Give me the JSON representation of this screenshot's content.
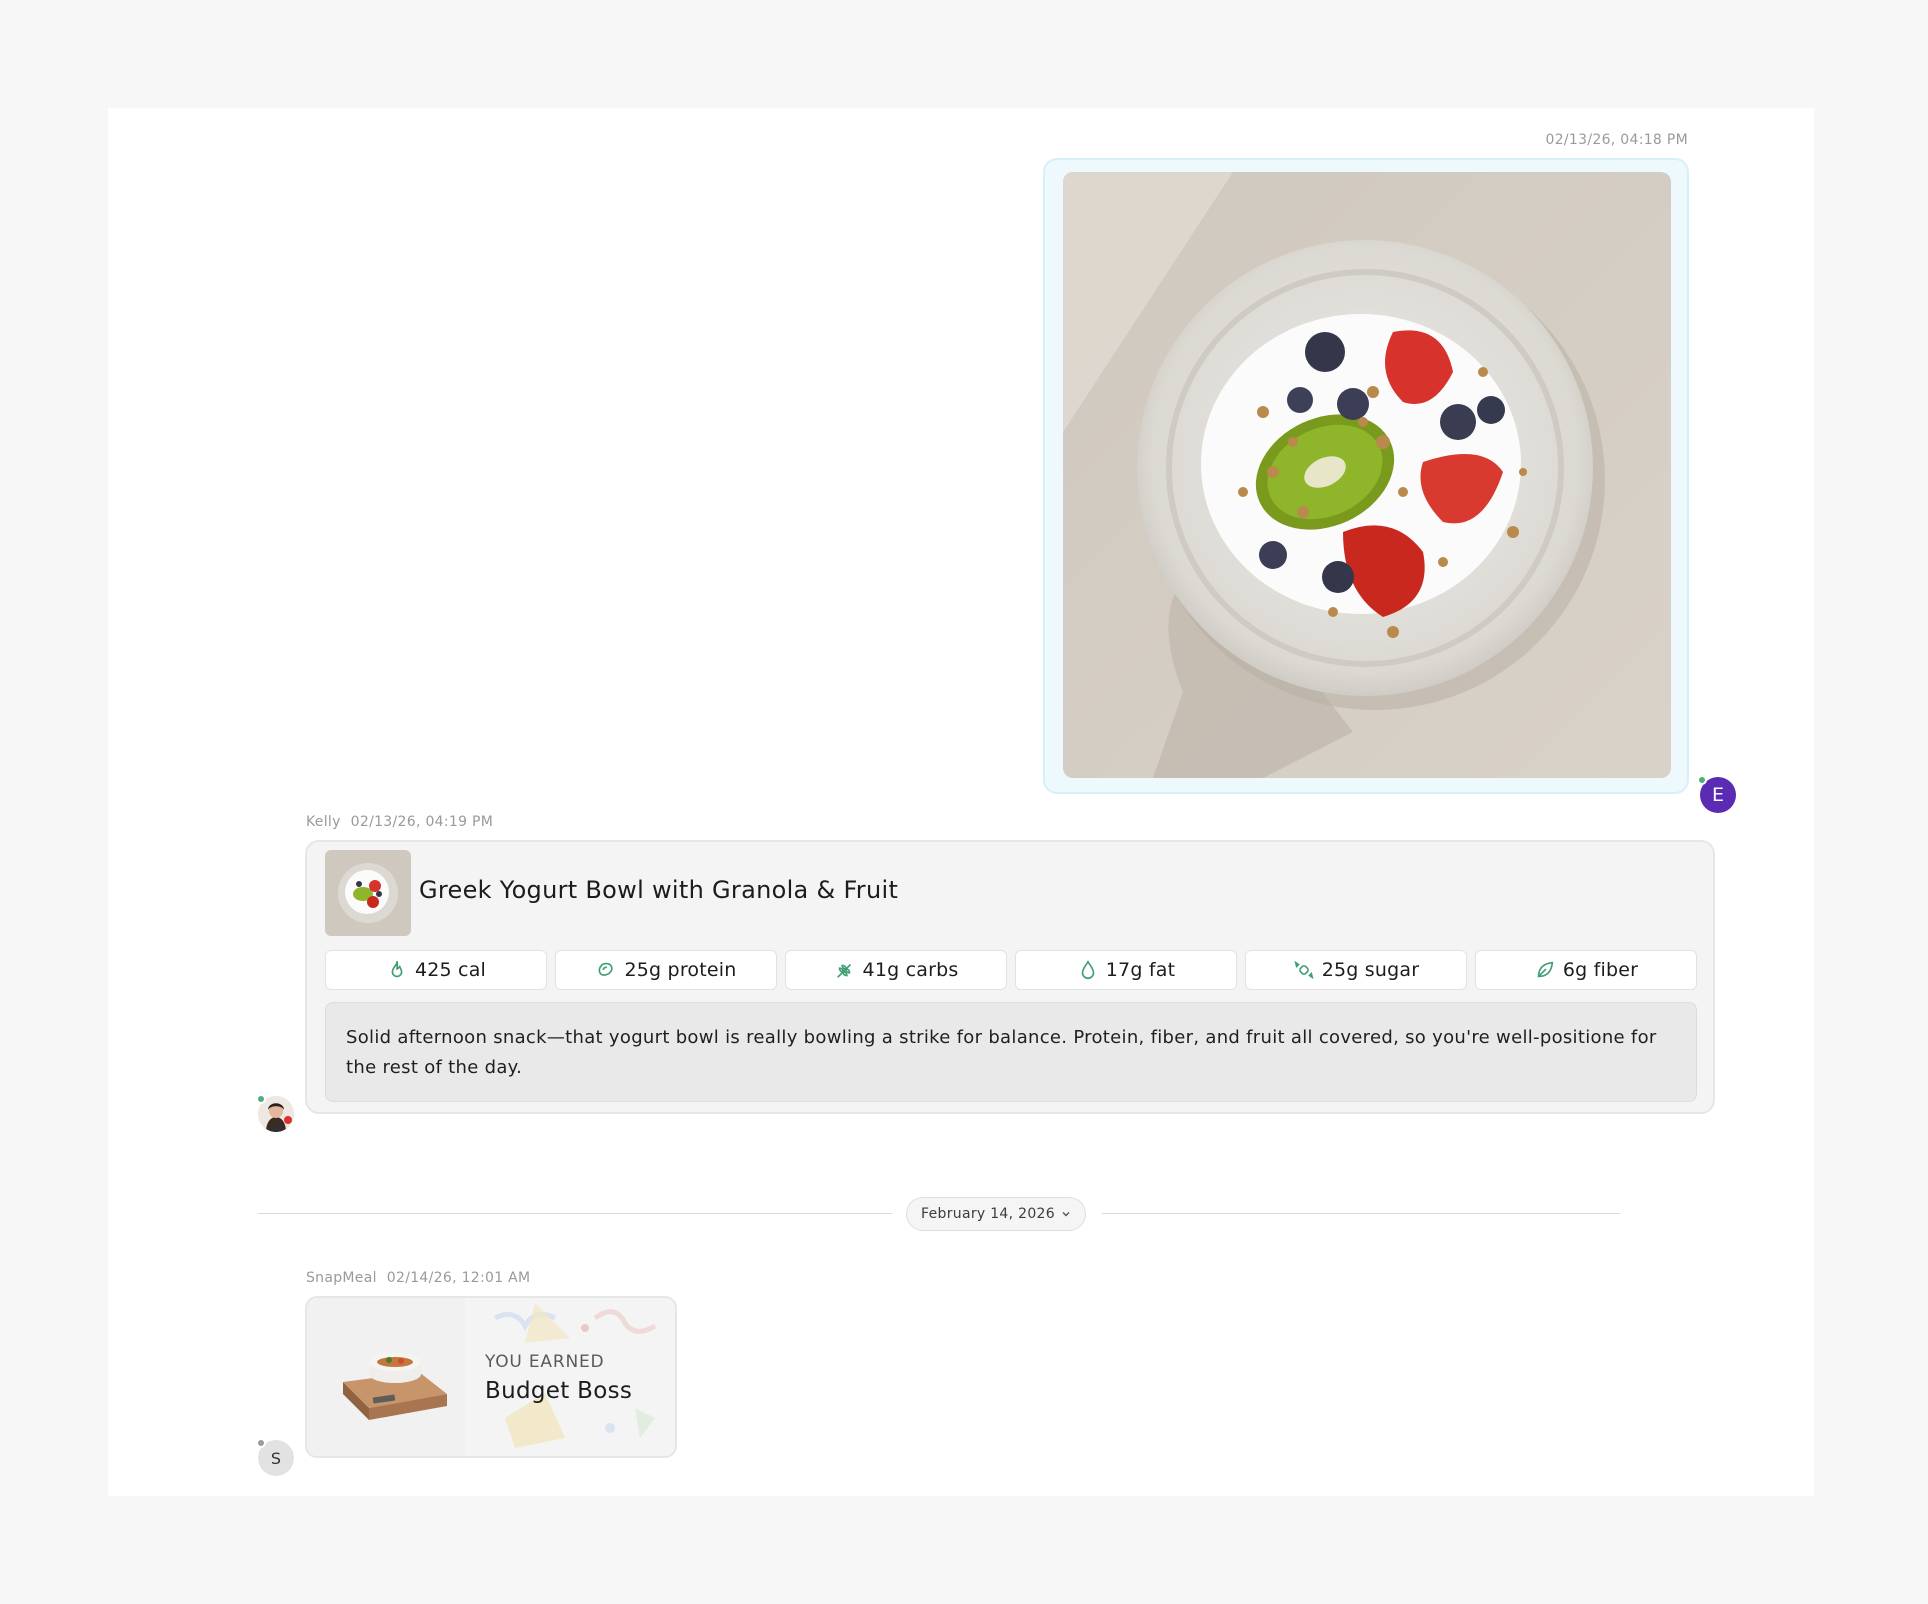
{
  "outgoing_message": {
    "timestamp": "02/13/26, 04:18 PM",
    "avatar_initial": "E",
    "avatar_color": "#5b2bb3"
  },
  "kelly_message": {
    "sender": "Kelly",
    "timestamp": "02/13/26, 04:19 PM",
    "meal_title": "Greek Yogurt Bowl with Granola & Fruit",
    "nutrients": [
      {
        "icon": "flame-icon",
        "label": "425 cal"
      },
      {
        "icon": "protein-icon",
        "label": "25g protein"
      },
      {
        "icon": "wheat-icon",
        "label": "41g carbs"
      },
      {
        "icon": "droplet-icon",
        "label": "17g fat"
      },
      {
        "icon": "candy-icon",
        "label": "25g sugar"
      },
      {
        "icon": "leaf-icon",
        "label": "6g fiber"
      }
    ],
    "note": "Solid afternoon snack—that yogurt bowl is really bowling a strike for balance. Protein, fiber, and fruit all covered, so you're well-positione for the rest of the day."
  },
  "date_divider": {
    "label": "February 14, 2026"
  },
  "snapmeal_message": {
    "sender": "SnapMeal",
    "timestamp": "02/14/26, 12:01 AM",
    "award_kicker": "YOU EARNED",
    "award_title": "Budget Boss",
    "avatar_initial": "S"
  },
  "colors": {
    "accent_green": "#3f9f72",
    "image_bubble_bg": "#eef9fd",
    "online": "#4bb07e"
  }
}
